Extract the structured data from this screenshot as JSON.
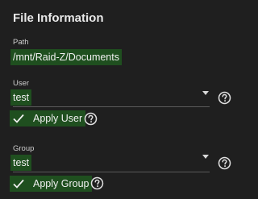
{
  "header": {
    "title": "File Information"
  },
  "path": {
    "label": "Path",
    "value": "/mnt/Raid-Z/Documents"
  },
  "user": {
    "label": "User",
    "value": "test",
    "checkbox_label": "Apply User",
    "checked": true
  },
  "group": {
    "label": "Group",
    "value": "test",
    "checkbox_label": "Apply Group",
    "checked": true
  },
  "colors": {
    "background": "#1f1f1f",
    "highlight": "#1f4f1f",
    "text": "#e6e6e6"
  },
  "icons": {
    "dropdown": "caret-down-icon",
    "help": "help-circle-icon",
    "check": "checkmark-icon"
  }
}
